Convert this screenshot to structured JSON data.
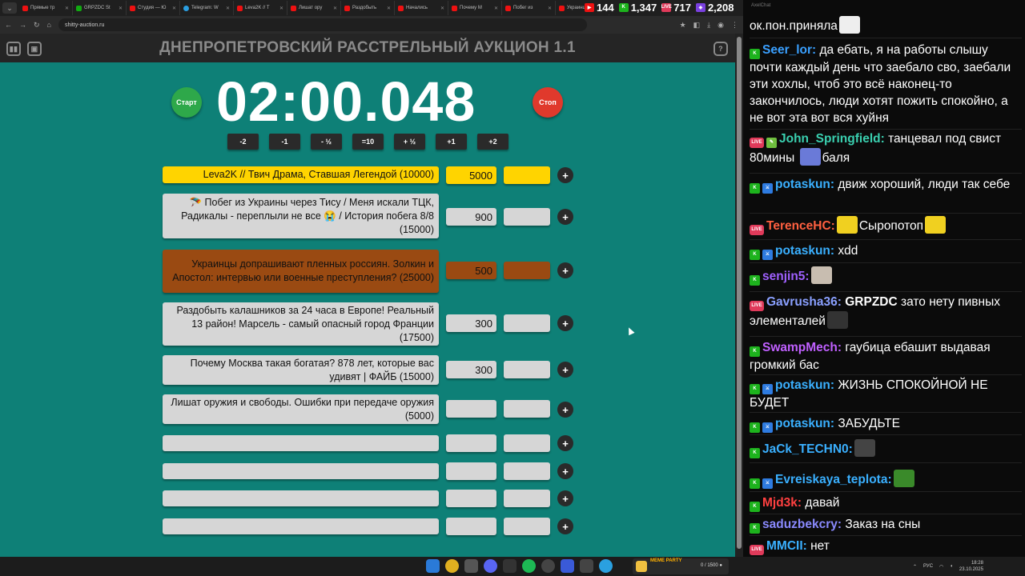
{
  "browser": {
    "tabs": [
      {
        "title": "Прямые тр",
        "icon": "youtube-icon"
      },
      {
        "title": "GRPZDC St",
        "icon": "grpzdc-icon"
      },
      {
        "title": "Студия — Ю",
        "icon": "youtube-icon"
      },
      {
        "title": "Telegram: W",
        "icon": "telegram-icon"
      },
      {
        "title": "Leva2K // T",
        "icon": "youtube-icon"
      },
      {
        "title": "Лишат ору",
        "icon": "youtube-icon"
      },
      {
        "title": "Раздобыть",
        "icon": "youtube-icon"
      },
      {
        "title": "Начались",
        "icon": "youtube-icon"
      },
      {
        "title": "Почему М",
        "icon": "youtube-icon"
      },
      {
        "title": "Побег из",
        "icon": "youtube-icon"
      },
      {
        "title": "Украинцы",
        "icon": "youtube-icon"
      }
    ],
    "url": "shitty-auction.ru"
  },
  "stats": {
    "youtube_viewers": "144",
    "kick_viewers": "1,347",
    "live_viewers": "717",
    "twitch_viewers": "2,208"
  },
  "auction": {
    "title": "ДНЕПРОПЕТРОВСКИЙ РАССТРЕЛЬНЫЙ АУКЦИОН 1.1",
    "timer": "02:00.048",
    "start_label": "Старт",
    "stop_label": "Стоп",
    "adjust_buttons": [
      "-2",
      "-1",
      "- ½",
      "=10",
      "+ ½",
      "+1",
      "+2"
    ],
    "lots": [
      {
        "title": "Leva2K // Твич Драма, Ставшая Легендой (10000)",
        "amount": "5000",
        "color": "#ffd400"
      },
      {
        "title": "🪂 Побег из Украины через Тису / Меня искали ТЦК, Радикалы - переплыли не все 😭 / История побега 8/8 (15000)",
        "amount": "900",
        "color": "#d6d6d6"
      },
      {
        "title": "Украинцы допрашивают пленных россиян. Золкин и Апостол: интервью или военные преступления? (25000)",
        "amount": "500",
        "color": "#9a4a12"
      },
      {
        "title": "Раздобыть калашников за 24 часа в Европе! Реальный 13 район! Марсель - самый опасный город Франции (17500)",
        "amount": "300",
        "color": "#d6d6d6"
      },
      {
        "title": "Почему Москва такая богатая? 878 лет, которые вас удивят | ФАЙБ (15000)",
        "amount": "300",
        "color": "#d6d6d6"
      },
      {
        "title": "Лишат оружия и свободы. Ошибки при передаче оружия (5000)",
        "amount": "",
        "color": "#d6d6d6"
      },
      {
        "title": "",
        "amount": "",
        "color": "#d6d6d6"
      },
      {
        "title": "",
        "amount": "",
        "color": "#d6d6d6"
      },
      {
        "title": "",
        "amount": "",
        "color": "#d6d6d6"
      },
      {
        "title": "",
        "amount": "",
        "color": "#d6d6d6"
      }
    ]
  },
  "chat": {
    "window_title": "AxelChat",
    "messages": [
      {
        "badge": "",
        "nick": "",
        "nick_color": "#ffffff",
        "text": "ок.пон.приняла",
        "emote": true
      },
      {
        "badge": "kick",
        "nick": "Seer_lor:",
        "nick_color": "#3aa0ff",
        "text": "да ебать, я на работы слышу почти каждый день что заебало сво, заебали эти хохлы, чтоб это всё наконец-то закончилось, люди хотят пожить спокойно, а не вот эта вот вся хуйня"
      },
      {
        "badge": "live",
        "nick": "John_Springfield:",
        "nick_color": "#3ad0b0",
        "text": "танцевал под свист 80мины",
        "text2": "баля",
        "emote": true
      },
      {
        "badge": "kick",
        "nick": "potaskun:",
        "nick_color": "#3ab0ff",
        "text": "движ хороший, люди так себе"
      },
      {
        "badge": "live",
        "nick": "TerenceHC:",
        "nick_color": "#ff6040",
        "text": "Сыропотоп"
      },
      {
        "badge": "kick",
        "nick": "potaskun:",
        "nick_color": "#3ab0ff",
        "text": "xdd"
      },
      {
        "badge": "kick",
        "nick": "senjin5:",
        "nick_color": "#a060ff",
        "text": ""
      },
      {
        "badge": "live",
        "nick": "Gavrusha36:",
        "nick_color": "#8aa0ff",
        "text": "GRPZDC",
        "text2": "зато нету пивных элементалей"
      },
      {
        "badge": "kick",
        "nick": "SwampMech:",
        "nick_color": "#c060ff",
        "text": "гаубица ебашит выдавая громкий бас"
      },
      {
        "badge": "kick",
        "nick": "potaskun:",
        "nick_color": "#3ab0ff",
        "text": "ЖИЗНЬ СПОКОЙНОЙ НЕ БУДЕТ"
      },
      {
        "badge": "kick",
        "nick": "potaskun:",
        "nick_color": "#3ab0ff",
        "text": "ЗАБУДЬТЕ"
      },
      {
        "badge": "kick",
        "nick": "JaCk_TECHN0:",
        "nick_color": "#3ab0ff",
        "text": ""
      },
      {
        "badge": "kick",
        "nick": "Evreiskaya_teplota:",
        "nick_color": "#3ab0ff",
        "text": ""
      },
      {
        "badge": "kick",
        "nick": "Mjd3k:",
        "nick_color": "#ff4040",
        "text": "давай"
      },
      {
        "badge": "kick",
        "nick": "saduzbekcry:",
        "nick_color": "#8a8aff",
        "text": "Заказ на сны"
      },
      {
        "badge": "live",
        "nick": "MMCII:",
        "nick_color": "#3ab0ff",
        "text": "нет"
      }
    ]
  },
  "taskbar": {
    "mp_label": "MEME PARTY",
    "mp_count": "0 / 1500 ●",
    "lang": "РУС",
    "time": "18:28",
    "date": "23.10.2025"
  }
}
